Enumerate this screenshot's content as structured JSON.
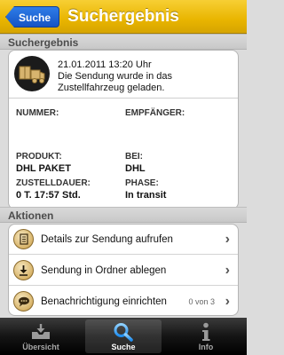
{
  "navbar": {
    "back_label": "Suche",
    "title": "Suchergebnis"
  },
  "result": {
    "section_title": "Suchergebnis",
    "message": {
      "datetime": "21.01.2011 13:20 Uhr",
      "text": "Die Sendung wurde in das Zustellfahrzeug geladen.",
      "icon": "package-truck-icon"
    },
    "fields": {
      "nummer_label": "NUMMER:",
      "empfaenger_label": "EMPFÄNGER:",
      "produkt_label": "PRODUKT:",
      "produkt_value": "DHL PAKET",
      "bei_label": "BEI:",
      "bei_value": "DHL",
      "zustelldauer_label": "ZUSTELLDAUER:",
      "zustelldauer_value": "0 T. 17:57 Std.",
      "phase_label": "PHASE:",
      "phase_value": "In transit"
    }
  },
  "actions": {
    "section_title": "Aktionen",
    "items": [
      {
        "label": "Details zur Sendung aufrufen",
        "icon": "document-icon"
      },
      {
        "label": "Sendung in Ordner ablegen",
        "icon": "download-arrow-icon"
      },
      {
        "label": "Benachrichtigung einrichten",
        "icon": "speech-bubble-icon",
        "count": "0 von 3"
      }
    ]
  },
  "tabbar": {
    "items": [
      {
        "label": "Übersicht",
        "icon": "inbox-tray-icon",
        "active": false
      },
      {
        "label": "Suche",
        "icon": "magnifier-icon",
        "active": true
      },
      {
        "label": "Info",
        "icon": "info-icon",
        "active": false
      }
    ]
  },
  "colors": {
    "navbar": "#e9b500",
    "back_button": "#1d62d6",
    "tabbar": "#141414"
  }
}
